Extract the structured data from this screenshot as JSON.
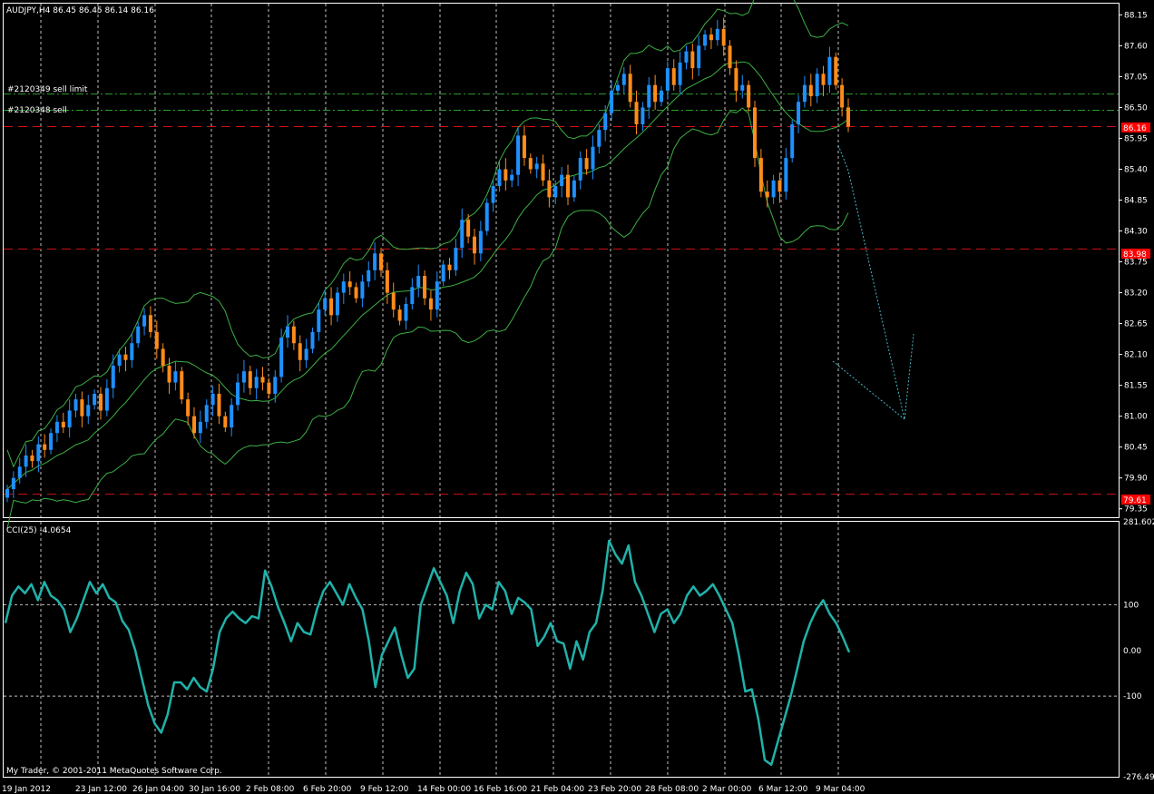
{
  "colors": {
    "background": "#000000",
    "grid": "#c0c0c0",
    "bull": "#1e90ff",
    "bear": "#ff8c1a",
    "bollinger": "#3cb043",
    "order_line": "#2e9c2e",
    "level_line": "#d01010",
    "label_bg": "#ff0000",
    "cci_line": "#20b2aa",
    "arrow": "#48b8c8"
  },
  "header": {
    "symbol_info": "AUDJPY,H4  86.45 86.45 86.14 86.16"
  },
  "orders": {
    "sell_limit_label": "#2120349 sell limit",
    "sell_label": "#2120348 sell"
  },
  "levels": {
    "current_price_label": "86.16",
    "level1_label": "83.98",
    "level2_label": "79.61"
  },
  "indicator": {
    "title": "CCI(25) -4.0654",
    "ticks": [
      "281.602",
      "100",
      "0.00",
      "-100",
      "-276.495"
    ]
  },
  "footer": {
    "copyright": "My Trader, © 2001-2011 MetaQuotes Software Corp."
  },
  "chart_data": {
    "type": "candlestick",
    "symbol": "AUDJPY",
    "timeframe": "H4",
    "price_ticks": [
      "88.15",
      "87.60",
      "87.05",
      "86.50",
      "85.95",
      "85.40",
      "84.85",
      "84.30",
      "83.75",
      "83.20",
      "82.65",
      "82.10",
      "81.55",
      "81.00",
      "80.45",
      "79.90",
      "79.35"
    ],
    "ylim": [
      79.2,
      88.35
    ],
    "time_labels": [
      "19 Jan 2012",
      "23 Jan 12:00",
      "26 Jan 04:00",
      "30 Jan 16:00",
      "2 Feb 08:00",
      "6 Feb 20:00",
      "9 Feb 12:00",
      "14 Feb 00:00",
      "16 Feb 16:00",
      "21 Feb 04:00",
      "23 Feb 20:00",
      "28 Feb 08:00",
      "2 Mar 00:00",
      "6 Mar 12:00",
      "9 Mar 04:00"
    ],
    "horizontal_levels": [
      {
        "price": 86.74,
        "style": "dash-dot",
        "label": "#2120349 sell limit"
      },
      {
        "price": 86.45,
        "style": "dash-dot",
        "label": "#2120348 sell"
      },
      {
        "price": 86.16,
        "style": "dashed"
      },
      {
        "price": 83.98,
        "style": "dashed"
      },
      {
        "price": 79.61,
        "style": "dashed"
      }
    ],
    "closes": [
      79.7,
      79.9,
      80.1,
      80.3,
      80.2,
      80.5,
      80.4,
      80.7,
      80.9,
      80.8,
      81.1,
      81.3,
      81.0,
      81.2,
      81.4,
      81.1,
      81.5,
      81.9,
      82.1,
      82.0,
      82.3,
      82.6,
      82.8,
      82.5,
      82.2,
      81.9,
      81.6,
      81.8,
      81.3,
      81.0,
      80.7,
      80.9,
      81.2,
      81.4,
      81.0,
      80.8,
      81.2,
      81.6,
      81.8,
      81.5,
      81.7,
      81.6,
      81.4,
      81.7,
      82.4,
      82.6,
      82.3,
      82.0,
      82.2,
      82.5,
      82.9,
      83.1,
      82.8,
      83.2,
      83.4,
      83.3,
      83.1,
      83.4,
      83.6,
      83.9,
      83.6,
      83.2,
      82.9,
      82.7,
      83.0,
      83.3,
      83.5,
      83.1,
      82.9,
      83.4,
      83.7,
      83.6,
      84.0,
      84.5,
      84.2,
      83.9,
      84.3,
      84.8,
      85.1,
      85.4,
      85.2,
      85.3,
      86.0,
      85.6,
      85.4,
      85.5,
      85.2,
      84.9,
      85.1,
      85.3,
      84.9,
      85.2,
      85.6,
      85.4,
      85.8,
      86.1,
      86.4,
      86.8,
      86.9,
      87.1,
      86.6,
      86.2,
      86.5,
      86.9,
      86.6,
      86.8,
      87.2,
      86.9,
      87.3,
      87.5,
      87.2,
      87.6,
      87.8,
      87.7,
      87.9,
      87.6,
      87.2,
      86.8,
      86.9,
      86.5,
      85.6,
      85.0,
      84.9,
      85.2,
      85.0,
      85.6,
      86.2,
      86.6,
      86.9,
      86.7,
      87.1,
      86.9,
      87.4,
      86.9,
      86.5,
      86.16
    ],
    "cci": {
      "name": "CCI(25)",
      "last": -4.0654,
      "ylim": [
        -276.495,
        281.602
      ],
      "levels": [
        100,
        0,
        -100
      ],
      "values": [
        60,
        120,
        140,
        125,
        145,
        110,
        150,
        120,
        110,
        90,
        40,
        70,
        110,
        150,
        125,
        145,
        115,
        105,
        65,
        45,
        0,
        -60,
        -120,
        -160,
        -180,
        -140,
        -70,
        -70,
        -85,
        -60,
        -80,
        -90,
        -40,
        40,
        70,
        85,
        70,
        60,
        75,
        70,
        175,
        140,
        95,
        60,
        20,
        60,
        40,
        35,
        90,
        130,
        150,
        125,
        100,
        145,
        115,
        90,
        20,
        -80,
        -10,
        20,
        50,
        -10,
        -60,
        -40,
        100,
        140,
        180,
        150,
        120,
        60,
        130,
        170,
        145,
        70,
        100,
        90,
        150,
        130,
        80,
        115,
        105,
        90,
        10,
        30,
        60,
        20,
        15,
        -40,
        20,
        -20,
        40,
        60,
        130,
        240,
        210,
        190,
        230,
        150,
        120,
        80,
        40,
        80,
        90,
        60,
        80,
        120,
        140,
        120,
        130,
        145,
        120,
        90,
        60,
        -10,
        -90,
        -85,
        -150,
        -240,
        -250,
        -200,
        -150,
        -100,
        -40,
        20,
        60,
        90,
        110,
        80,
        60,
        30,
        -4.0654
      ]
    }
  }
}
